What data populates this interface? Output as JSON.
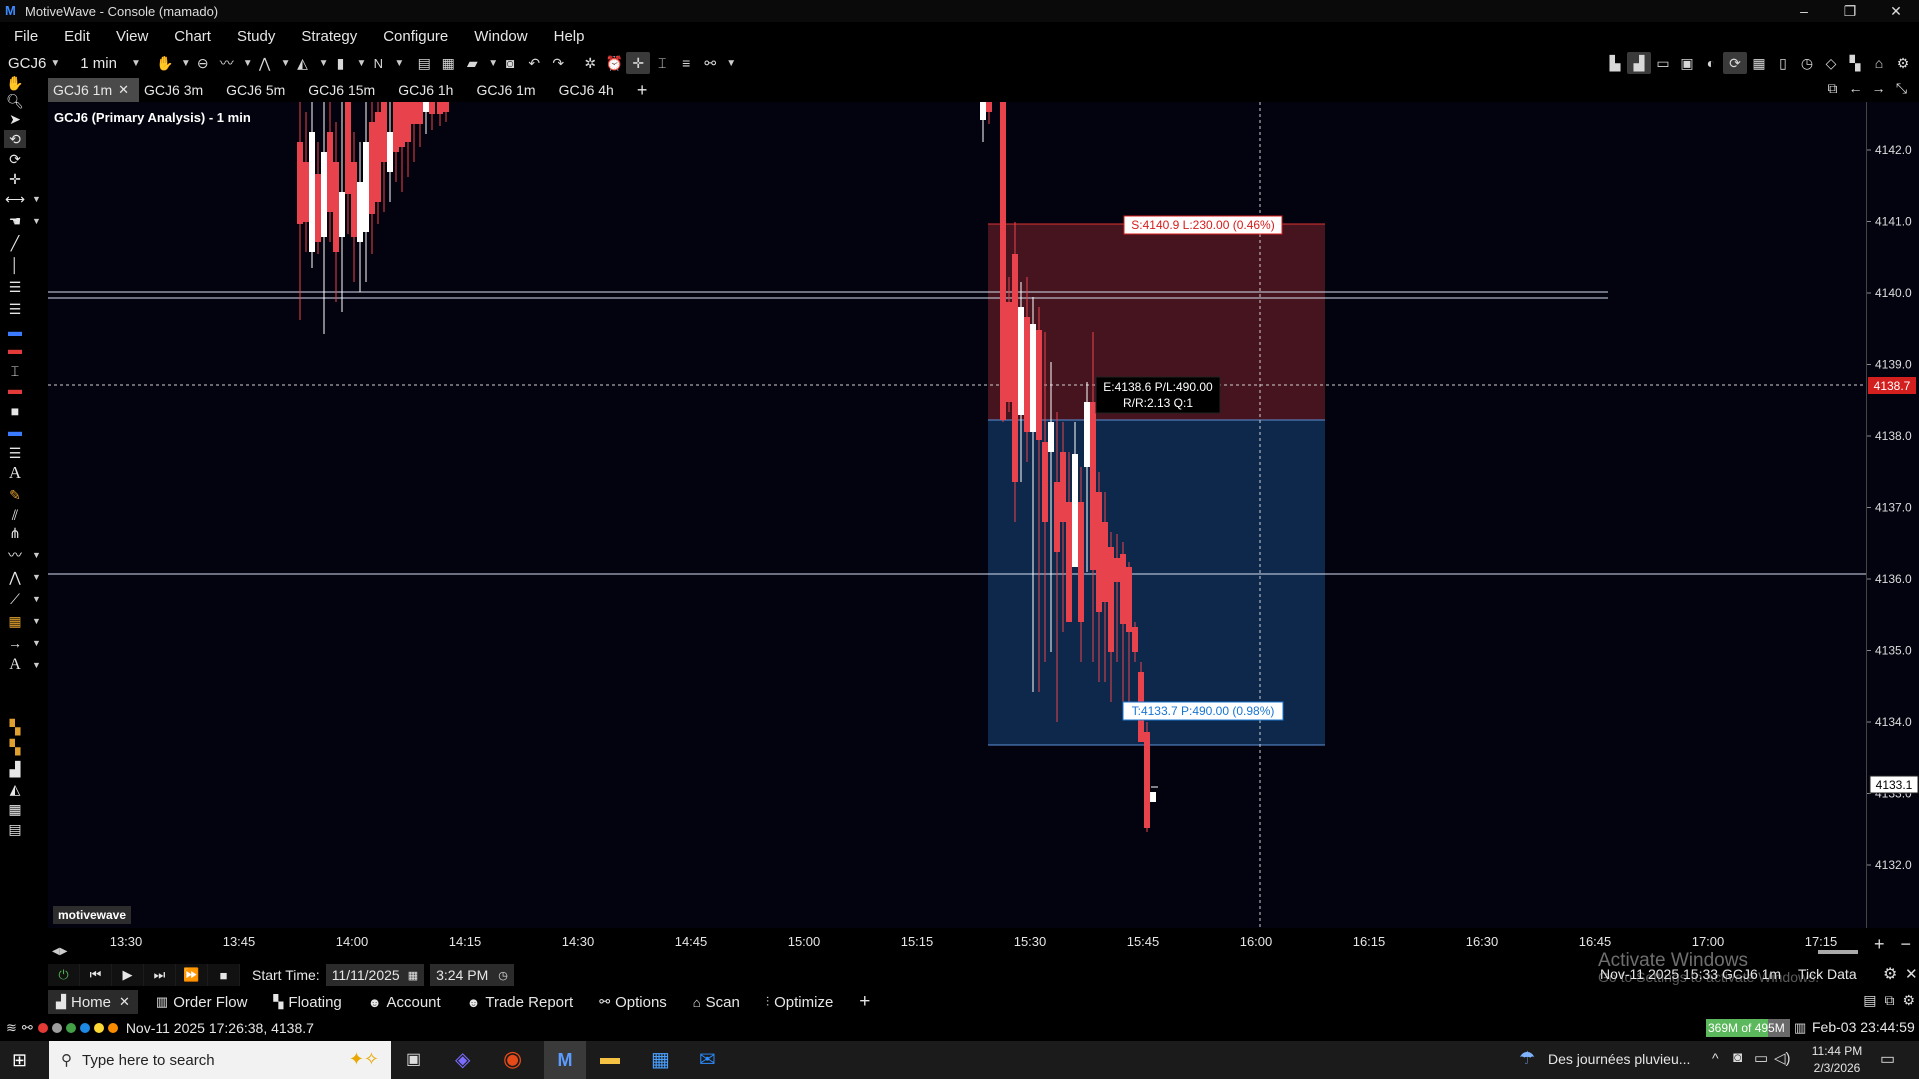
{
  "window": {
    "title": "MotiveWave - Console (mamado)",
    "controls": [
      "–",
      "❐",
      "✕"
    ]
  },
  "menu": [
    "File",
    "Edit",
    "View",
    "Chart",
    "Study",
    "Strategy",
    "Configure",
    "Window",
    "Help"
  ],
  "toolbar": {
    "symbol": "GCJ6",
    "interval": "1 min",
    "n_label": "N"
  },
  "tabs": [
    {
      "label": "GCJ6 1m",
      "active": true
    },
    {
      "label": "GCJ6 3m"
    },
    {
      "label": "GCJ6 5m"
    },
    {
      "label": "GCJ6 15m"
    },
    {
      "label": "GCJ6 1h"
    },
    {
      "label": "GCJ6 1m"
    },
    {
      "label": "GCJ6 4h"
    }
  ],
  "tab_add": "+",
  "chart": {
    "title": "GCJ6 (Primary Analysis) - 1 min",
    "watermark": "motivewave",
    "price_ticks": [
      "4142.0",
      "4141.0",
      "4140.0",
      "4139.0",
      "4138.0",
      "4137.0",
      "4136.0",
      "4135.0",
      "4134.0",
      "4133.0",
      "4132.0"
    ],
    "time_ticks": [
      "13:30",
      "13:45",
      "14:00",
      "14:15",
      "14:30",
      "14:45",
      "15:00",
      "15:15",
      "15:30",
      "15:45",
      "16:00",
      "16:15",
      "16:30",
      "16:45",
      "17:00",
      "17:15"
    ],
    "crosshair_price": "4138.7",
    "last_price": "4133.1",
    "stop_label": "S:4140.9 L:230.00 (0.46%)",
    "entry_label_1": "E:4138.6 P/L:490.00",
    "entry_label_2": "R/R:2.13 Q:1",
    "target_label": "T:4133.7 P:490.00 (0.98%)",
    "colors": {
      "up": "#ffffff",
      "down": "#e8434d",
      "stop_zone": "#4a1520",
      "target_zone": "#0f2a4f",
      "crosshair_tag": "#d41f1f"
    },
    "zoom_controls": [
      "+",
      "−"
    ]
  },
  "replay": {
    "start_label": "Start Time:",
    "date": "11/11/2025",
    "time": "3:24 PM",
    "info": "Nov-11 2025 15:33  GCJ6 1m",
    "tick_data": "Tick Data"
  },
  "activate": {
    "line1": "Activate Windows",
    "line2": "Go to Settings to activate Windows."
  },
  "bottom_nav": [
    {
      "label": "Home",
      "icon": "bar-chart-icon",
      "active": true
    },
    {
      "label": "Order Flow",
      "icon": "order-flow-icon"
    },
    {
      "label": "Floating",
      "icon": "floating-icon"
    },
    {
      "label": "Account",
      "icon": "account-icon"
    },
    {
      "label": "Trade Report",
      "icon": "trade-report-icon"
    },
    {
      "label": "Options",
      "icon": "options-icon"
    },
    {
      "label": "Scan",
      "icon": "scan-icon"
    },
    {
      "label": "Optimize",
      "icon": "optimize-icon"
    }
  ],
  "status": {
    "text": "Nov-11 2025 17:26:38, 4138.7",
    "memory": "369M of 495M",
    "clock": "Feb-03 23:44:59"
  },
  "taskbar": {
    "search_placeholder": "Type here to search",
    "weather": "Des journées pluvieu...",
    "time": "11:44 PM",
    "date": "2/3/2026"
  }
}
